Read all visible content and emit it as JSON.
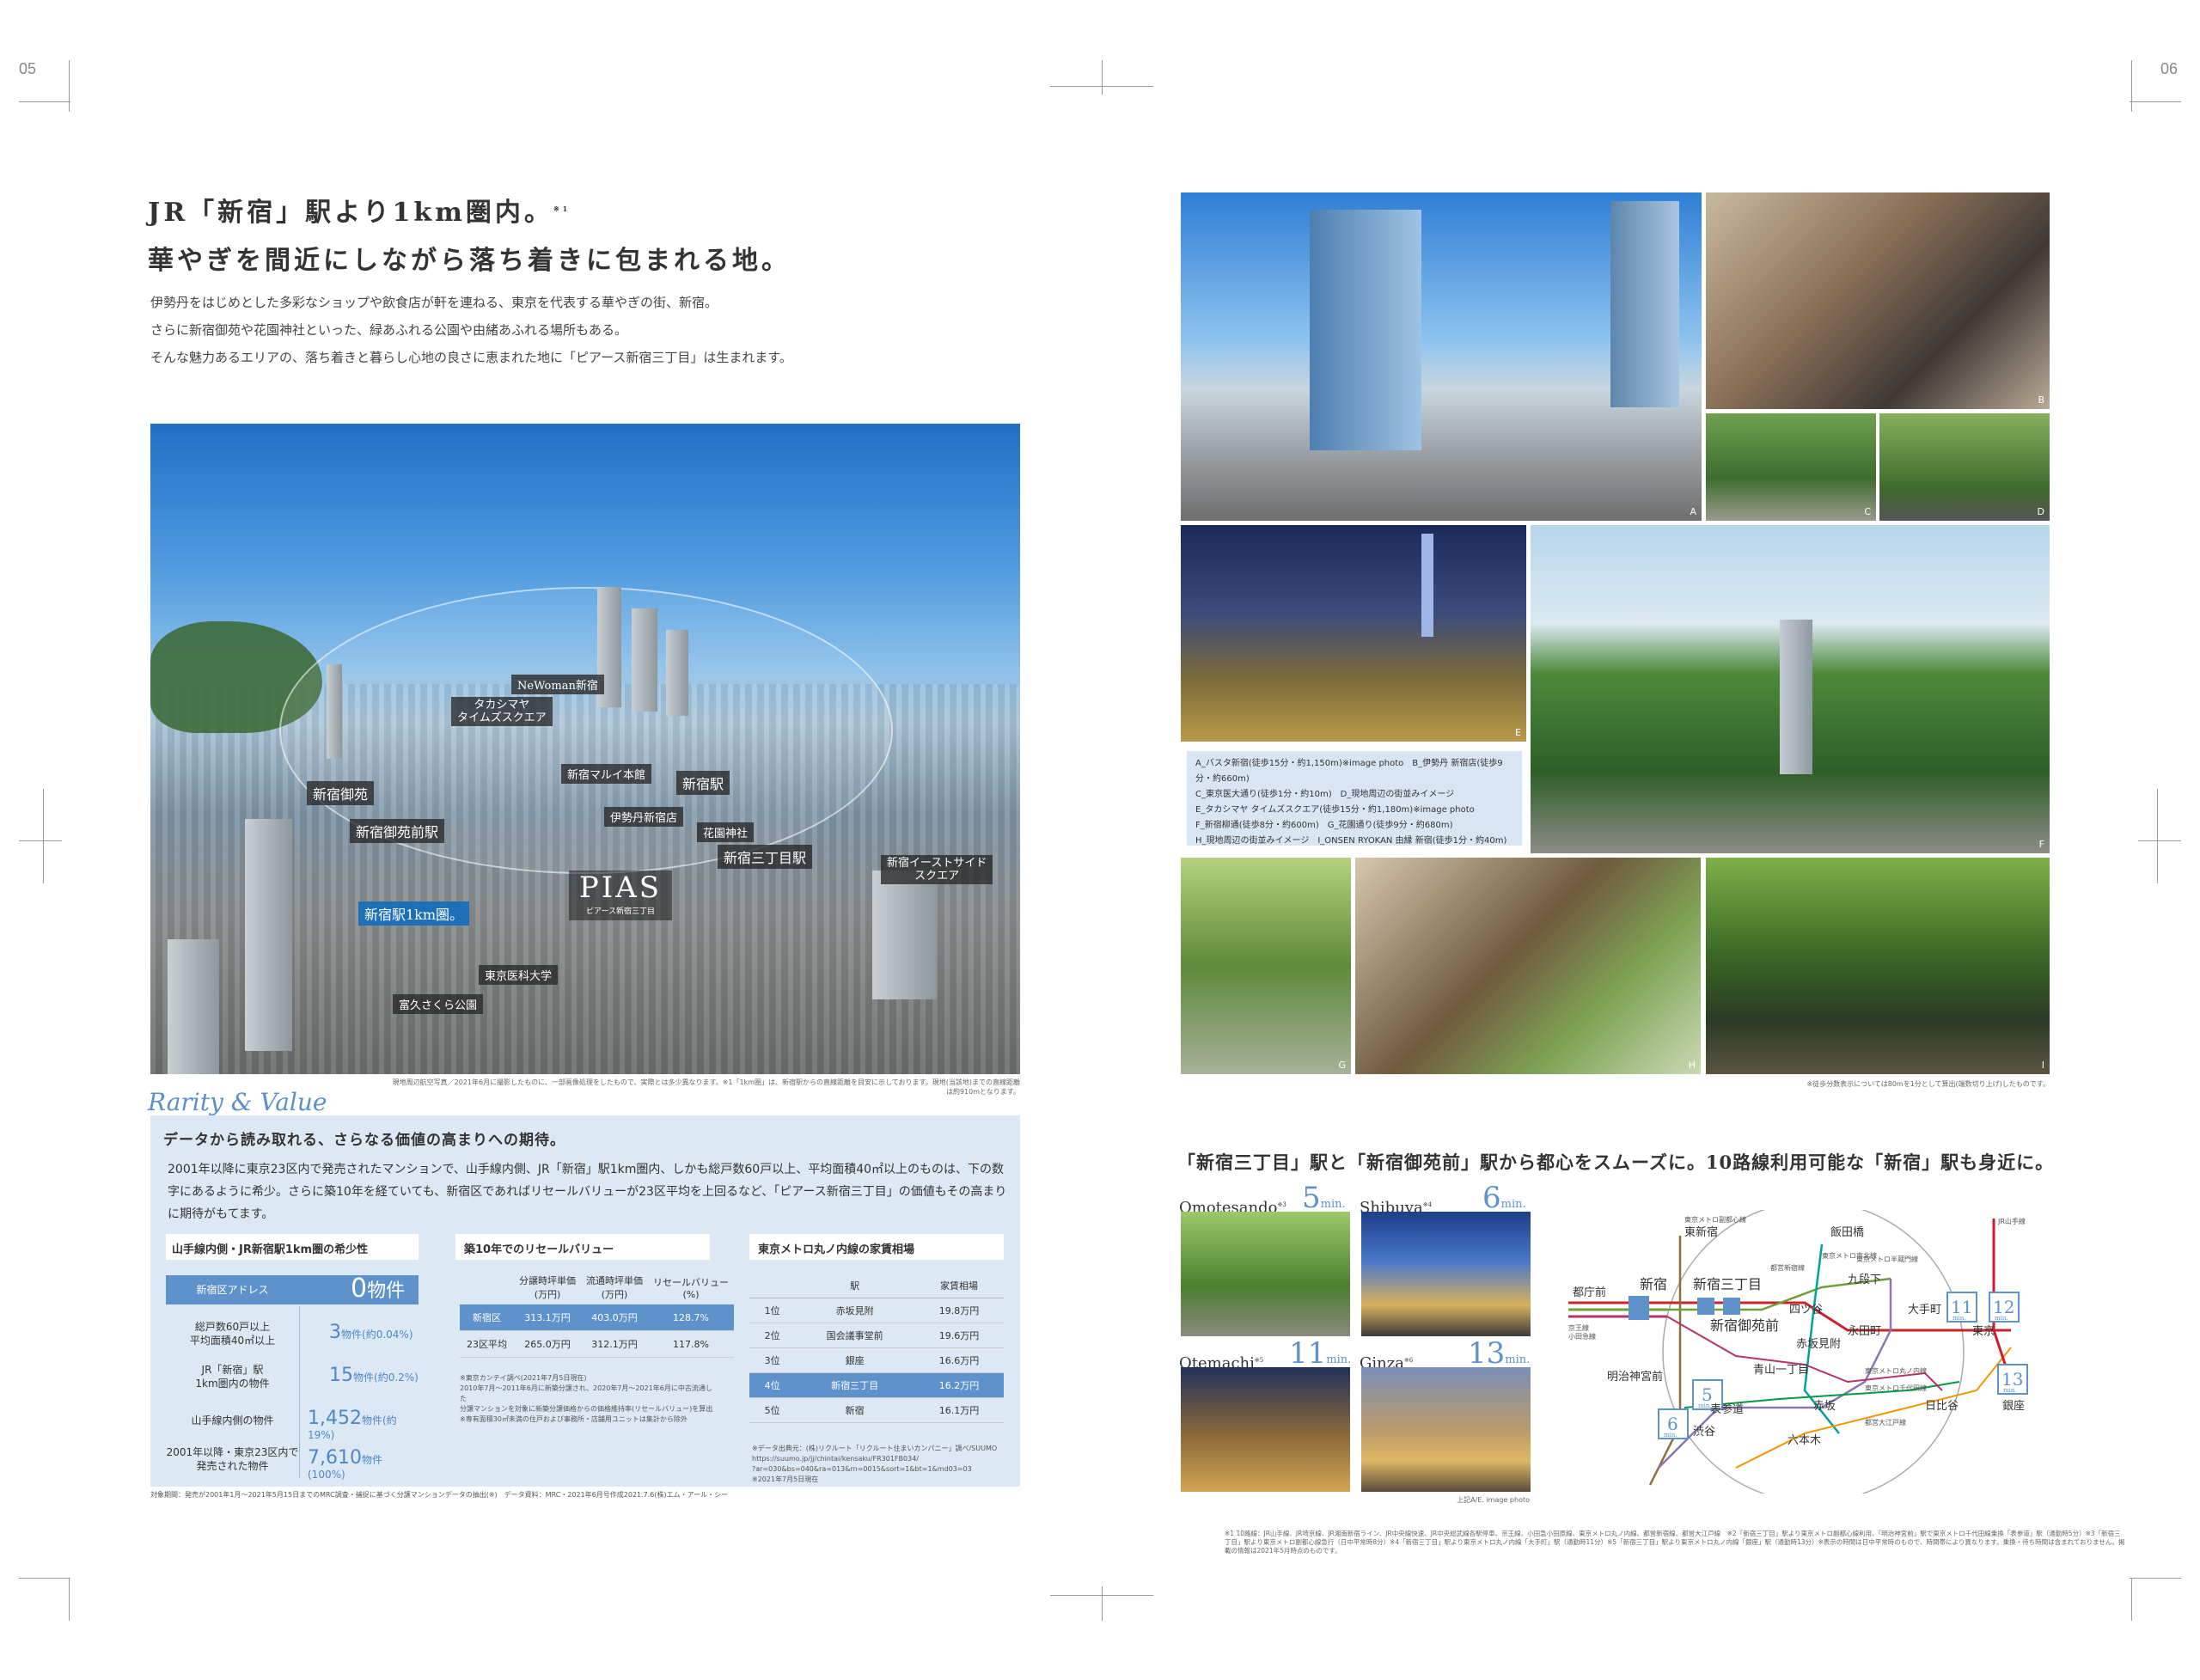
{
  "page_numbers": {
    "left": "05",
    "right": "06"
  },
  "headline": {
    "line1": "JR「新宿」駅より1km圏内。",
    "line2": "華やぎを間近にしながら落ち着きに包まれる地。",
    "note_mark": "※1"
  },
  "intro": [
    "伊勢丹をはじめとした多彩なショップや飲食店が軒を連ねる、東京を代表する華やぎの街、新宿。",
    "さらに新宿御苑や花園神社といった、緑あふれる公園や由緒あふれる場所もある。",
    "そんな魅力あるエリアの、落ち着きと暮らし心地の良さに恵まれた地に「ピアース新宿三丁目」は生まれます。"
  ],
  "aerial": {
    "labels": {
      "newoman": "NeWoman新宿",
      "takashimaya": "タカシマヤ\nタイムズスクエア",
      "marui": "新宿マルイ本館",
      "shinjuku_sta": "新宿駅",
      "gyoen": "新宿御苑",
      "gyoenmae": "新宿御苑前駅",
      "isetan": "伊勢丹新宿店",
      "hanazono": "花園神社",
      "sanchome": "新宿三丁目駅",
      "eastside": "新宿イーストサイド\nスクエア",
      "km": "新宿駅1km圏。",
      "ika": "東京医科大学",
      "park": "富久さくら公園"
    },
    "logo": "PIAS",
    "logo_sub": "ピアース新宿三丁目",
    "caption": "現地周辺航空写真／2021年6月に撮影したものに、一部画像処理をしたもので、実際とは多少異なります。※1「1km圏」は、新宿駅からの直線距離を目安に示しております。現地(当該地)までの直線距離は約910mとなります。"
  },
  "rarity": {
    "title": "Rarity & Value",
    "lead": "データから読み取れる、さらなる価値の高まりへの期待。",
    "body": "2001年以降に東京23区内で発売されたマンションで、山手線内側、JR「新宿」駅1km圏内、しかも総戸数60戸以上、平均面積40㎡以上のものは、下の数字にあるように希少。さらに築10年を経ていても、新宿区であればリセールバリューが23区平均を上回るなど、「ピアース新宿三丁目」の価値もその高まりに期待がもてます。",
    "box1": {
      "title": "山手線内側・JR新宿駅1km圏の希少性",
      "rows": [
        {
          "label": "新宿区アドレス",
          "value": "0",
          "unit": "物件",
          "pct": ""
        },
        {
          "label": "総戸数60戸以上\n平均面積40㎡以上",
          "value": "3",
          "unit": "物件",
          "pct": "(約0.04%)"
        },
        {
          "label": "JR「新宿」駅\n1km圏内の物件",
          "value": "15",
          "unit": "物件",
          "pct": "(約0.2%)"
        },
        {
          "label": "山手線内側の物件",
          "value": "1,452",
          "unit": "物件",
          "pct": "(約19%)"
        },
        {
          "label": "2001年以降・東京23区内で\n発売された物件",
          "value": "7,610",
          "unit": "物件",
          "pct": "(100%)"
        }
      ]
    },
    "box2": {
      "title": "築10年でのリセールバリュー",
      "headers": [
        "",
        "分譲時坪単価\n(万円)",
        "流通時坪単価\n(万円)",
        "リセールバリュー\n(%)"
      ],
      "rows": [
        [
          "新宿区",
          "313.1万円",
          "403.0万円",
          "128.7%"
        ],
        [
          "23区平均",
          "265.0万円",
          "312.1万円",
          "117.8%"
        ]
      ],
      "note": "※東京カンテイ調べ(2021年7月5日現在)\n2010年7月〜2011年6月に新築分譲され、2020年7月〜2021年6月に中古流通した\n分譲マンションを対象に新築分譲価格からの価格維持率(リセールバリュー)を算出\n※専有面積30㎡未満の住戸および事務所・店舗用ユニットは集計から除外"
    },
    "box3": {
      "title": "東京メトロ丸ノ内線の家賃相場",
      "headers": [
        "",
        "駅",
        "家賃相場"
      ],
      "rows": [
        [
          "1位",
          "赤坂見附",
          "19.8万円"
        ],
        [
          "2位",
          "国会議事堂前",
          "19.6万円"
        ],
        [
          "3位",
          "銀座",
          "16.6万円"
        ],
        [
          "4位",
          "新宿三丁目",
          "16.2万円"
        ],
        [
          "5位",
          "新宿",
          "16.1万円"
        ]
      ],
      "note": "※データ出典元：(株)リクルート「リクルート住まいカンパニー」調べ/SUUMO\nhttps://suumo.jp/jj/chintai/kensaku/FR301FB034/\n?ar=030&bs=040&ra=013&rn=0015&sort=1&bt=1&md03=03\n※2021年7月5日現在"
    },
    "footnote": "対象期間：発売が2001年1月〜2021年5月15日までのMRC調査・捕捉に基づく分譲マンションデータの抽出(※)　データ資料：MRC・2021年6月号作成2021.7.6(株)エム・アール・シー"
  },
  "photos": {
    "letters": [
      "A",
      "B",
      "C",
      "D",
      "E",
      "F",
      "G",
      "H",
      "I"
    ],
    "legend": [
      "A_バスタ新宿(徒歩15分・約1,150m)※image photo　B_伊勢丹 新宿店(徒歩9分・約660m)",
      "C_東京医大通り(徒歩1分・約10m)　D_現地周辺の街並みイメージ",
      "E_タカシマヤ タイムズスクエア(徒歩15分・約1,180m)※image photo",
      "F_新宿柳通(徒歩8分・約600m)　G_花園通り(徒歩9分・約680m)",
      "H_現地周辺の街並みイメージ　I_ONSEN RYOKAN 由縁 新宿(徒歩1分・約40m)"
    ],
    "caption": "※徒歩分数表示については80mを1分として算出(端数切り上げ)したものです。"
  },
  "access": {
    "title": "「新宿三丁目」駅と「新宿御苑前」駅から都心をスムーズに。10路線利用可能な「新宿」駅も身近に。",
    "destinations": [
      {
        "name": "Omotesando",
        "mark": "※3",
        "minutes": "5",
        "unit": "min."
      },
      {
        "name": "Shibuya",
        "mark": "※4",
        "minutes": "6",
        "unit": "min."
      },
      {
        "name": "Otemachi",
        "mark": "※5",
        "minutes": "11",
        "unit": "min."
      },
      {
        "name": "Ginza",
        "mark": "※6",
        "minutes": "13",
        "unit": "min."
      }
    ],
    "photo_caption": "上記A/E. image photo",
    "map": {
      "stations": [
        "東新宿",
        "飯田橋",
        "新宿",
        "新宿三丁目",
        "新宿御苑前",
        "都庁前",
        "四ツ谷",
        "九段下",
        "大手町",
        "永田町",
        "赤坂見附",
        "東京",
        "明治神宮前",
        "青山一丁目",
        "表参道",
        "赤坂",
        "日比谷",
        "銀座",
        "渋谷",
        "六本木"
      ],
      "lines": [
        "東京メトロ副都心線",
        "都営新宿線",
        "東京メトロ半蔵門線",
        "東京メトロ南北線",
        "東京メトロ丸ノ内線",
        "東京メトロ千代田線",
        "都営大江戸線",
        "京王線",
        "小田急線",
        "JR山手線"
      ],
      "mins": {
        "otemachi": "11",
        "tokyo": "12",
        "ginza": "13",
        "omotesando": "5",
        "shibuya": "6"
      },
      "min_unit": "min."
    },
    "footnote": "※1 10路線：JR山手線、JR埼京線、JR湘南新宿ライン、JR中央線快速、JR中央総武線各駅停車、京王線、小田急小田原線、東京メトロ丸ノ内線、都営新宿線、都営大江戸線　※2「新宿三丁目」駅より東京メトロ副都心線利用、「明治神宮前」駅で東京メトロ千代田線乗換「表参道」駅（通勤時5分）※3「新宿三丁目」駅より東京メトロ副都心線急行（日中平常時8分）※4「新宿三丁目」駅より東京メトロ丸ノ内線「大手町」駅（通勤時11分）※5「新宿三丁目」駅より東京メトロ丸ノ内線「銀座」駅（通勤時13分）※表示の時間は日中平常時のもので、時間帯により異なります。乗換・待ち時間は含まれておりません。掲載の情報は2021年5月時点のものです。"
  },
  "colors": {
    "accent": "#5e92cb",
    "panel": "#dce8f4",
    "label_bg": "#2b2b2b",
    "kmlabel": "#1d6fb8"
  }
}
